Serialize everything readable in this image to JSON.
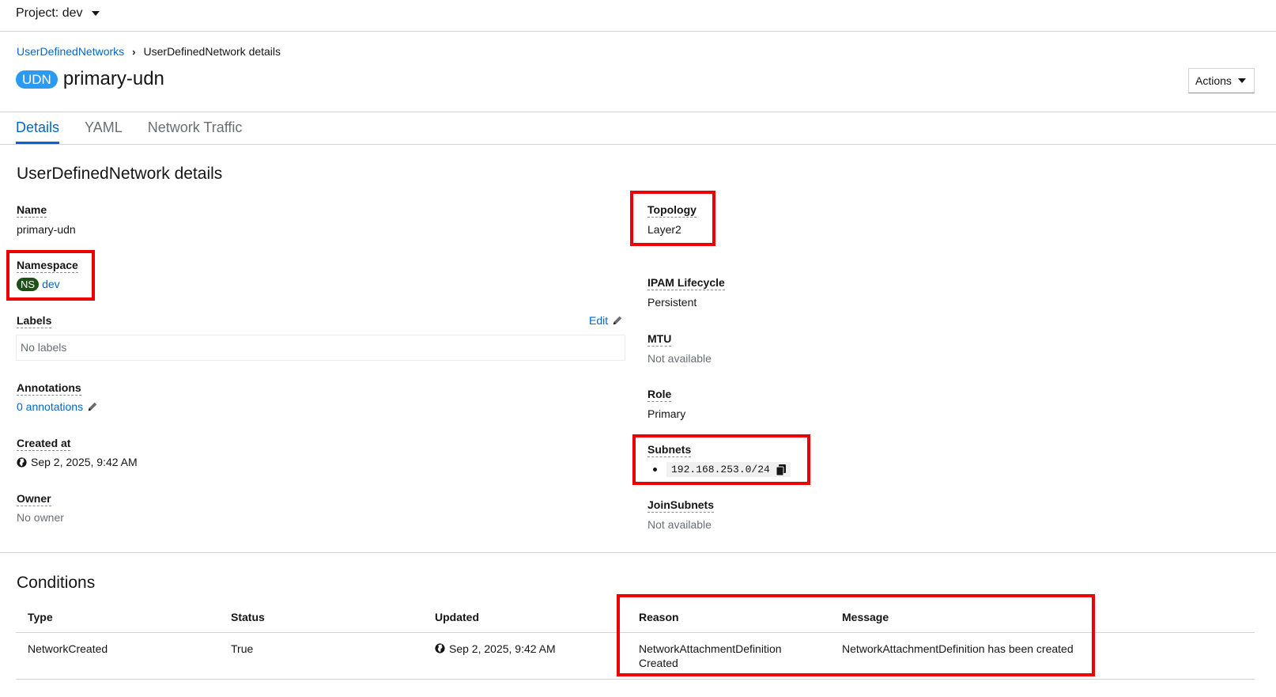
{
  "project": {
    "label": "Project: dev"
  },
  "breadcrumb": {
    "parent": "UserDefinedNetworks",
    "current": "UserDefinedNetwork details"
  },
  "header": {
    "badge": "UDN",
    "title": "primary-udn",
    "actions_label": "Actions"
  },
  "tabs": [
    {
      "label": "Details"
    },
    {
      "label": "YAML"
    },
    {
      "label": "Network Traffic"
    }
  ],
  "details": {
    "section_title": "UserDefinedNetwork details",
    "name": {
      "label": "Name",
      "value": "primary-udn"
    },
    "namespace": {
      "label": "Namespace",
      "badge": "NS",
      "value": "dev"
    },
    "labels": {
      "label": "Labels",
      "edit": "Edit",
      "value": "No labels"
    },
    "annotations": {
      "label": "Annotations",
      "value": "0 annotations"
    },
    "created_at": {
      "label": "Created at",
      "value": "Sep 2, 2025, 9:42 AM"
    },
    "owner": {
      "label": "Owner",
      "value": "No owner"
    },
    "topology": {
      "label": "Topology",
      "value": "Layer2"
    },
    "ipam_lifecycle": {
      "label": "IPAM Lifecycle",
      "value": "Persistent"
    },
    "mtu": {
      "label": "MTU",
      "value": "Not available"
    },
    "role": {
      "label": "Role",
      "value": "Primary"
    },
    "subnets": {
      "label": "Subnets",
      "items": [
        "192.168.253.0/24"
      ]
    },
    "join_subnets": {
      "label": "JoinSubnets",
      "value": "Not available"
    }
  },
  "conditions": {
    "title": "Conditions",
    "columns": [
      "Type",
      "Status",
      "Updated",
      "Reason",
      "Message"
    ],
    "rows": [
      {
        "type": "NetworkCreated",
        "status": "True",
        "updated": "Sep 2, 2025, 9:42 AM",
        "reason_line1": "NetworkAttachmentDefinition",
        "reason_line2": "Created",
        "message": "NetworkAttachmentDefinition has been created"
      }
    ]
  },
  "colors": {
    "link": "#0066cc",
    "udn_badge": "#2b9af3",
    "ns_badge": "#1e4f18",
    "highlight": "#ee0000"
  }
}
